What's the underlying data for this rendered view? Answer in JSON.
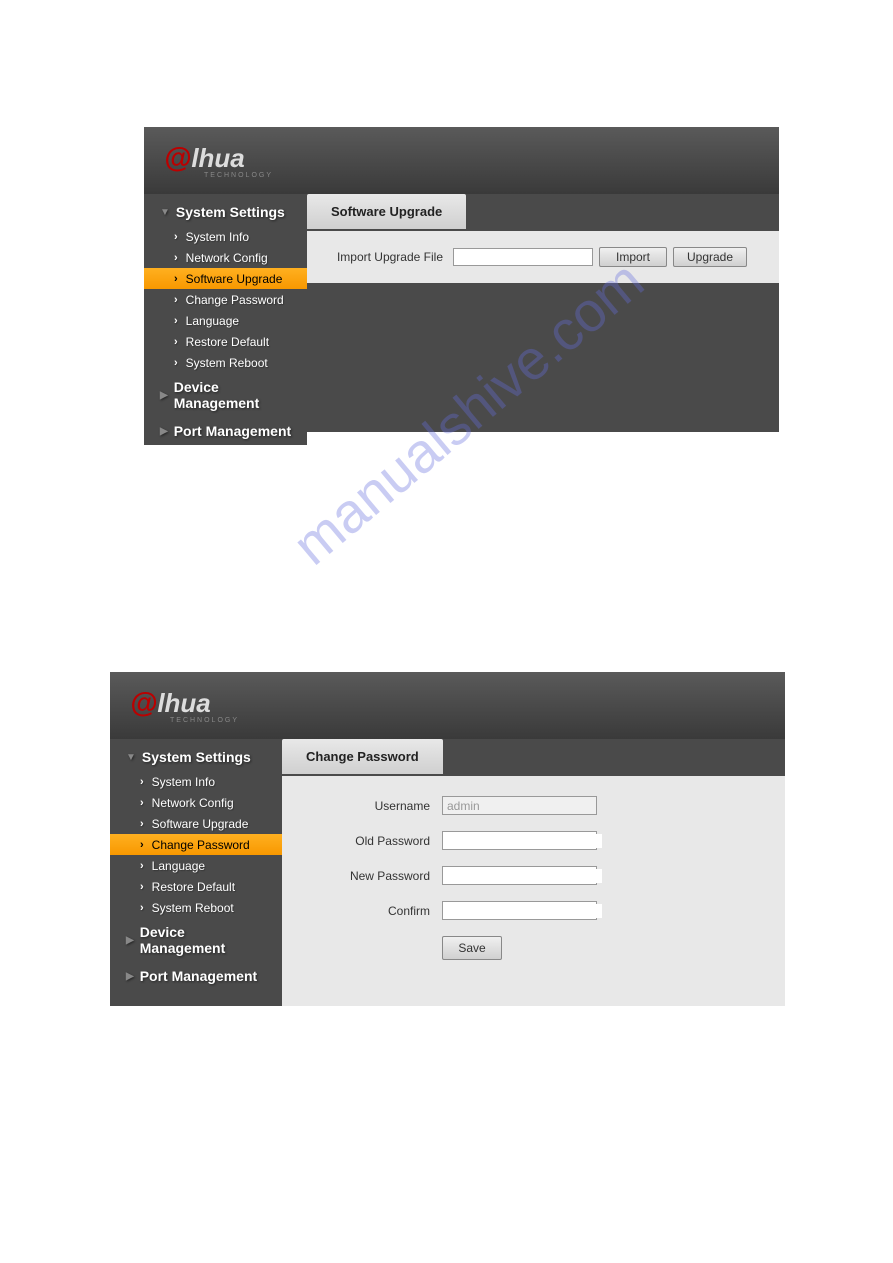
{
  "brand": {
    "at": "@",
    "name": "lhua",
    "sub": "TECHNOLOGY"
  },
  "panel1": {
    "sidebar": {
      "sections": [
        {
          "label": "System Settings",
          "expanded": true,
          "items": [
            "System Info",
            "Network Config",
            "Software Upgrade",
            "Change Password",
            "Language",
            "Restore Default",
            "System Reboot"
          ],
          "activeIndex": 2
        },
        {
          "label": "Device Management",
          "expanded": false
        },
        {
          "label": "Port Management",
          "expanded": false
        }
      ]
    },
    "tab": "Software Upgrade",
    "form": {
      "file_label": "Import Upgrade File",
      "file_value": "",
      "import_btn": "Import",
      "upgrade_btn": "Upgrade"
    }
  },
  "panel2": {
    "sidebar": {
      "sections": [
        {
          "label": "System Settings",
          "expanded": true,
          "items": [
            "System Info",
            "Network Config",
            "Software Upgrade",
            "Change Password",
            "Language",
            "Restore Default",
            "System Reboot"
          ],
          "activeIndex": 3
        },
        {
          "label": "Device Management",
          "expanded": false
        },
        {
          "label": "Port Management",
          "expanded": false
        }
      ]
    },
    "tab": "Change Password",
    "form": {
      "username_label": "Username",
      "username_value": "admin",
      "oldpw_label": "Old Password",
      "newpw_label": "New Password",
      "confirm_label": "Confirm",
      "save_btn": "Save"
    }
  },
  "watermark": "manualshive.com"
}
